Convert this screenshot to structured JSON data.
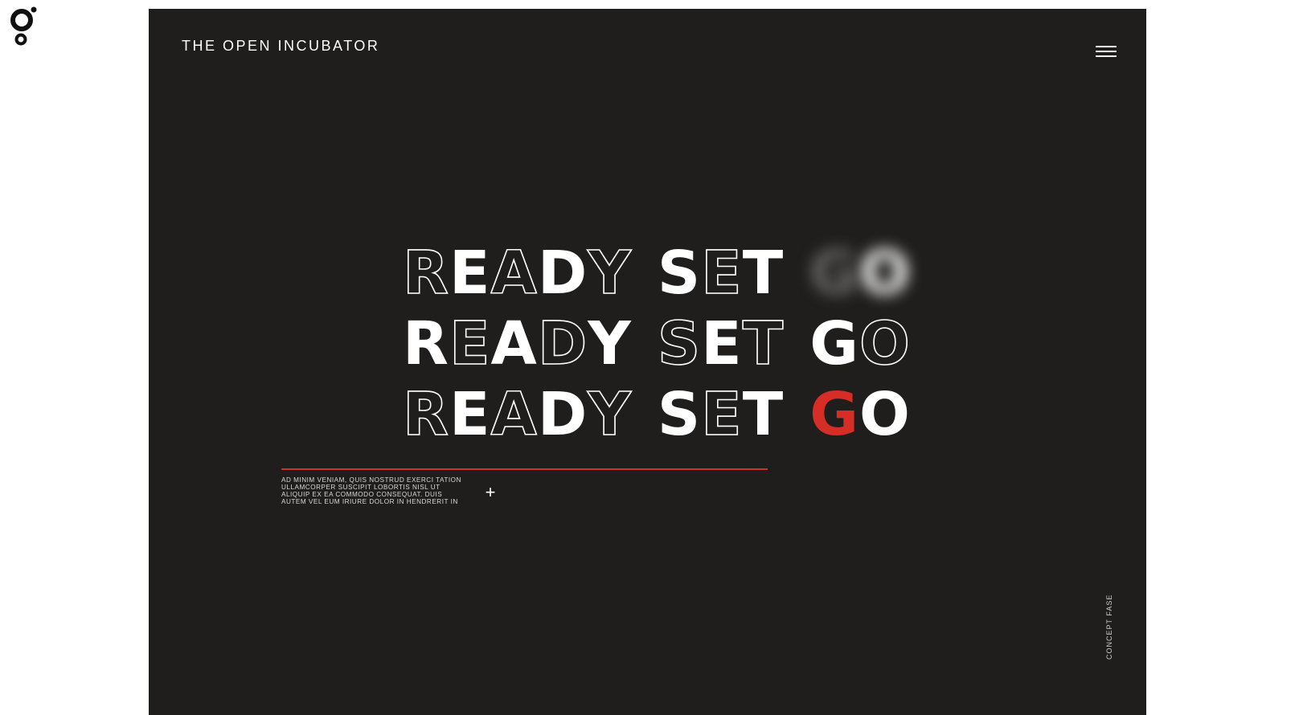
{
  "logo": {
    "icon": "brand-logo-icon"
  },
  "header": {
    "brand": "THE OPEN INCUBATOR",
    "menu_icon": "hamburger-menu-icon"
  },
  "hero": {
    "lines": [
      [
        "R",
        "E",
        "A",
        "D",
        "Y",
        "S",
        "E",
        "T",
        "G",
        "O"
      ],
      [
        "R",
        "E",
        "A",
        "D",
        "Y",
        "S",
        "E",
        "T",
        "G",
        "O"
      ],
      [
        "R",
        "E",
        "A",
        "D",
        "Y",
        "S",
        "E",
        "T",
        "G",
        "O"
      ]
    ]
  },
  "intro": {
    "text": "AD MINIM VENIAM, QUIS NOSTRUD EXERCI TATION ULLAMCORPER SUSCIPIT LOBORTIS NISL UT ALIQUIP EX EA COMMODO CONSEQUAT. DUIS AUTEM VEL EUM IRIURE DOLOR IN HENDRERIT IN",
    "expand_icon": "plus-icon",
    "expand_label": "+"
  },
  "phase_label": "CONCEPT FASE",
  "colors": {
    "frame_background": "#1f1e1d",
    "accent": "#d62e26",
    "text": "#ffffff"
  }
}
